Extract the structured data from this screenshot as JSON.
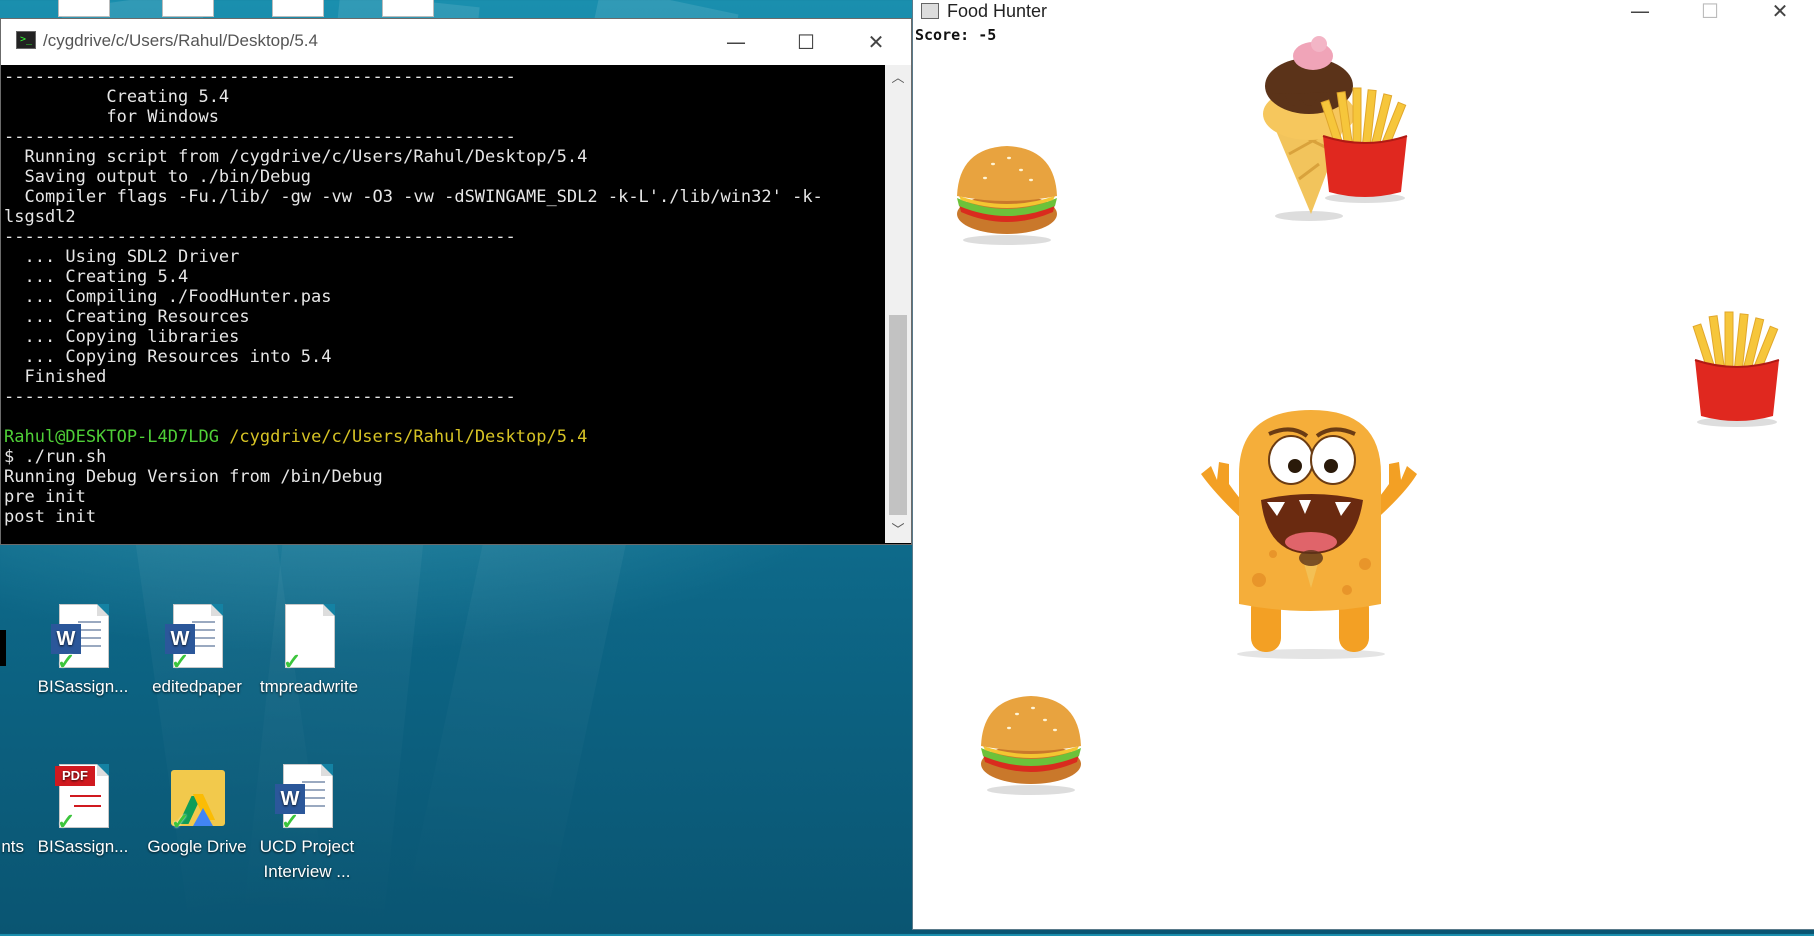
{
  "desktop": {
    "icons": [
      {
        "label": "BISassign...",
        "type": "word"
      },
      {
        "label": "editedpaper",
        "type": "word"
      },
      {
        "label": "tmpreadwrite",
        "type": "file"
      },
      {
        "label": "BISassign...",
        "type": "pdf"
      },
      {
        "label": "Google Drive",
        "type": "drive"
      },
      {
        "label": "UCD Project Interview ...",
        "type": "word"
      },
      {
        "label": "nts",
        "type": "partial"
      }
    ]
  },
  "terminal": {
    "title": "/cygdrive/c/Users/Rahul/Desktop/5.4",
    "lines": [
      "--------------------------------------------------",
      "          Creating 5.4",
      "          for Windows",
      "--------------------------------------------------",
      "  Running script from /cygdrive/c/Users/Rahul/Desktop/5.4",
      "  Saving output to ./bin/Debug",
      "  Compiler flags -Fu./lib/ -gw -vw -O3 -vw -dSWINGAME_SDL2 -k-L'./lib/win32' -k-",
      "lsgsdl2",
      "--------------------------------------------------",
      "  ... Using SDL2 Driver",
      "  ... Creating 5.4",
      "  ... Compiling ./FoodHunter.pas",
      "  ... Creating Resources",
      "  ... Copying libraries",
      "  ... Copying Resources into 5.4",
      "  Finished",
      "--------------------------------------------------",
      ""
    ],
    "prompt_user": "Rahul@DESKTOP-L4D7LDG",
    "prompt_path": "/cygdrive/c/Users/Rahul/Desktop/5.4",
    "command": "$ ./run.sh",
    "output": [
      "Running Debug Version from /bin/Debug",
      "pre init",
      "post init"
    ]
  },
  "game": {
    "title": "Food Hunter",
    "score_text": "Score:  -5",
    "colors": {
      "monster": "#f5a623",
      "bun": "#e39a33",
      "fries_box": "#e0281f",
      "fries": "#f6c63b"
    }
  },
  "window_controls": {
    "minimize": "—",
    "maximize": "☐",
    "close": "✕"
  }
}
